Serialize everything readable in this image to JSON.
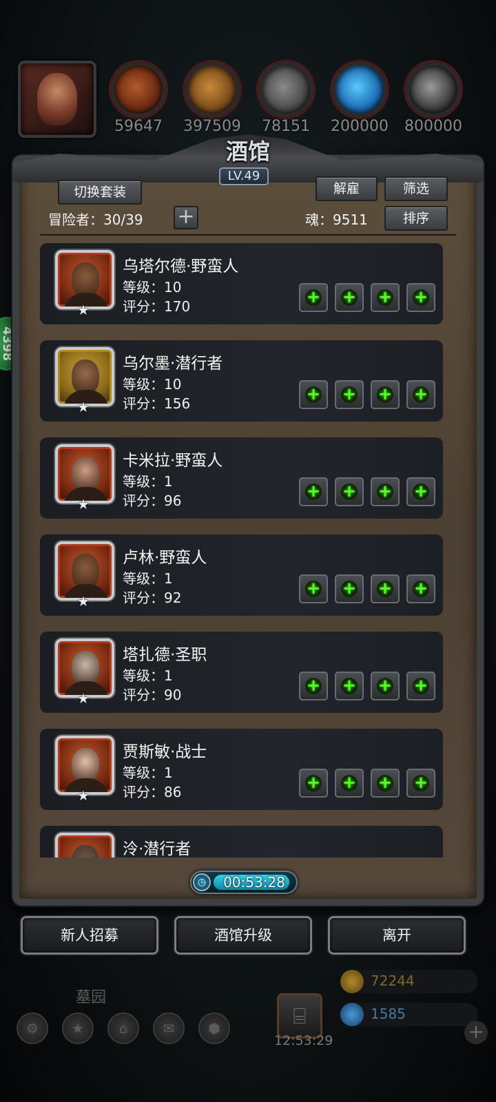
{
  "resources": [
    {
      "icon": "meat-icon",
      "value": "59647"
    },
    {
      "icon": "wood-icon",
      "value": "397509"
    },
    {
      "icon": "stone-icon",
      "value": "78151"
    },
    {
      "icon": "crystal-icon",
      "value": "200000"
    },
    {
      "icon": "iron-icon",
      "value": "800000"
    }
  ],
  "side_badge": "4398",
  "panel": {
    "title": "酒馆",
    "level": "LV.49",
    "switch_outfit": "切换套装",
    "hire": "解雇",
    "filter": "筛选",
    "sort": "排序",
    "adventurers_label": "冒险者：30/39",
    "add_symbol": "+",
    "soul_label": "魂：9511"
  },
  "heroes": [
    {
      "name": "乌塔尔德·野蛮人",
      "level": "等级：10",
      "score": "评分：170",
      "frame": "red",
      "skin": "#8a5a3a"
    },
    {
      "name": "乌尔墨·潜行者",
      "level": "等级：10",
      "score": "评分：156",
      "frame": "gold",
      "skin": "#9a6a4a"
    },
    {
      "name": "卡米拉·野蛮人",
      "level": "等级：1",
      "score": "评分：96",
      "frame": "red",
      "skin": "#d09a80"
    },
    {
      "name": "卢林·野蛮人",
      "level": "等级：1",
      "score": "评分：92",
      "frame": "red",
      "skin": "#8a5a3a"
    },
    {
      "name": "塔扎德·圣职",
      "level": "等级：1",
      "score": "评分：90",
      "frame": "red",
      "skin": "#c8b8a8"
    },
    {
      "name": "贾斯敏·战士",
      "level": "等级：1",
      "score": "评分：86",
      "frame": "red",
      "skin": "#e0c0a8"
    },
    {
      "name": "泠·潜行者",
      "level": "",
      "score": "",
      "frame": "red",
      "skin": "#6a5a4a"
    }
  ],
  "timer": {
    "text": "00:53:28",
    "progress": 0.95
  },
  "buttons": {
    "recruit": "新人招募",
    "upgrade": "酒馆升级",
    "leave": "离开"
  },
  "background": {
    "graveyard": "墓园",
    "clock": "12:53:29",
    "gold": "72244",
    "gems": "1585"
  }
}
